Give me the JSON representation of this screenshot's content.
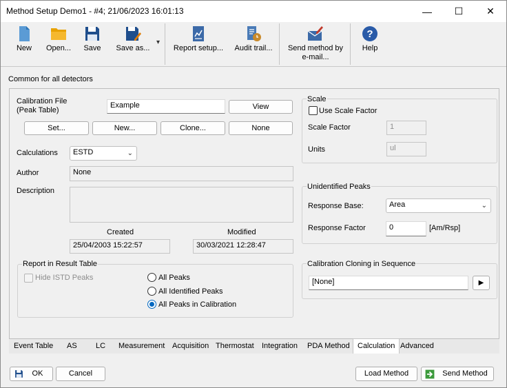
{
  "window": {
    "title": "Method Setup Demo1 - #4;  21/06/2023   16:01:13",
    "controls": {
      "minimize": "—",
      "maximize": "☐",
      "close": "✕"
    }
  },
  "toolbar": {
    "items": [
      {
        "label": "New",
        "icon": "new-document-icon"
      },
      {
        "label": "Open...",
        "icon": "folder-open-icon"
      },
      {
        "label": "Save",
        "icon": "floppy-disk-icon"
      },
      {
        "label": "Save as...",
        "icon": "save-as-icon"
      },
      {
        "label": "Report setup...",
        "icon": "report-setup-icon"
      },
      {
        "label": "Audit trail...",
        "icon": "audit-trail-icon"
      },
      {
        "label": "Send method by e-mail...",
        "label_line1": "Send method by",
        "label_line2": "e-mail...",
        "icon": "email-icon"
      },
      {
        "label": "Help",
        "icon": "help-icon"
      }
    ],
    "dropdown_arrow": "▾"
  },
  "section_title": "Common for all detectors",
  "calibration": {
    "file_label_line1": "Calibration File",
    "file_label_line2": "(Peak Table)",
    "file_value": "Example",
    "view_button": "View",
    "set_button": "Set...",
    "new_button": "New...",
    "clone_button": "Clone...",
    "none_button": "None"
  },
  "calculations": {
    "label": "Calculations",
    "value": "ESTD"
  },
  "author": {
    "label": "Author",
    "value": "None"
  },
  "description": {
    "label": "Description",
    "value": ""
  },
  "created": {
    "label": "Created",
    "value": "25/04/2003 15:22:57"
  },
  "modified": {
    "label": "Modified",
    "value": "30/03/2021 12:28:47"
  },
  "report": {
    "title": "Report in Result Table",
    "hide_istd": "Hide ISTD Peaks",
    "options": [
      "All Peaks",
      "All Identified Peaks",
      "All Peaks in Calibration"
    ],
    "selected_index": 2
  },
  "scale": {
    "title": "Scale",
    "use_scale_factor": "Use Scale Factor",
    "scale_factor_label": "Scale Factor",
    "scale_factor_value": "1",
    "units_label": "Units",
    "units_value": "ul"
  },
  "unidentified": {
    "title": "Unidentified Peaks",
    "response_base_label": "Response Base:",
    "response_base_value": "Area",
    "response_factor_label": "Response Factor",
    "response_factor_value": "0",
    "response_factor_unit": "[Am/Rsp]"
  },
  "cloning": {
    "title": "Calibration Cloning in Sequence",
    "value": "[None]",
    "arrow": "▶"
  },
  "tabs": [
    "Event Table",
    "AS",
    "LC",
    "Measurement",
    "Acquisition",
    "Thermostat",
    "Integration",
    "PDA Method",
    "Calculation",
    "Advanced"
  ],
  "active_tab": "Calculation",
  "footer": {
    "ok": "OK",
    "cancel": "Cancel",
    "load_method": "Load Method",
    "send_method": "Send Method"
  },
  "colors": {
    "accent": "#0067c0",
    "icon_blue": "#1f4e8c",
    "folder": "#f0a500",
    "help": "#2a5ba8",
    "send_green": "#3c9a3c"
  }
}
